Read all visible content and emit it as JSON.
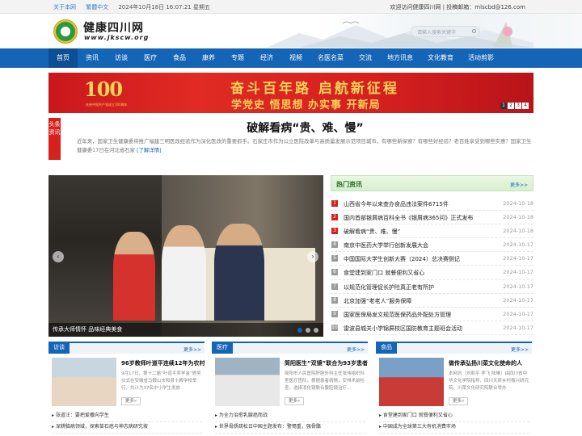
{
  "topbar": {
    "about": "关于本网",
    "traditional": "繁體中文",
    "datetime": "2024年10月18日 16:07:21 星期五",
    "welcome": "欢迎访问健康四川网 | 投稿邮箱：mlscbd@126.com"
  },
  "header": {
    "site_name": "健康四川网",
    "site_url": "www.jkscw.org",
    "search_placeholder": "请输入搜索关键字"
  },
  "nav": {
    "items": [
      "首页",
      "资讯",
      "访谈",
      "医疗",
      "食品",
      "康养",
      "专题",
      "经济",
      "视频",
      "名医名菜",
      "交流",
      "地方讯息",
      "文化教育",
      "活动剪影"
    ]
  },
  "banner": {
    "badge": "100",
    "badge_sub": "庆祝中国共产党成立100周年",
    "line1": "奋斗百年路  启航新征程",
    "line2": "学党史  悟思想  办实事  开新局",
    "pages": [
      "1",
      "2",
      "3",
      "4"
    ]
  },
  "headline": {
    "tag": "头条资讯",
    "title": "破解看病“贵、难、慢”",
    "body": "近年来，国家卫生健康委将推广福建三明医改经验作为深化医改的重要抓手。石家庄市作为公立医院改革与高质量发展示范项目城市，有哪些新探索？有哪些好经验？老百姓享受到哪些实惠？国家卫生健康委17日在河北省石家",
    "more": "[了解详情]"
  },
  "slider": {
    "caption": "传承大师情怀 品味经典美食",
    "prev": "‹",
    "next": "›"
  },
  "hot": {
    "title": "热门资讯",
    "more": "更多>>",
    "items": [
      {
        "n": "1",
        "title": "山西省今年以来查办食品违法案件6715件",
        "date": "2024-10-18"
      },
      {
        "n": "2",
        "title": "国内首部银屑病百科全书《银屑病365问》正式发布",
        "date": "2024-10-18"
      },
      {
        "n": "3",
        "title": "破解看病“贵、难、慢”",
        "date": "2024-10-18"
      },
      {
        "n": "4",
        "title": "南京中医药大学举行创新发展大会",
        "date": "2024-10-17"
      },
      {
        "n": "5",
        "title": "中国国际大学生创新大赛（2024）总决赛侧记",
        "date": "2024-10-17"
      },
      {
        "n": "6",
        "title": "食堂建到家门口 就餐便利又省心",
        "date": "2024-10-17"
      },
      {
        "n": "7",
        "title": "以规范化管理促长护险真正老有所护",
        "date": "2024-10-17"
      },
      {
        "n": "8",
        "title": "北京加强“老老人”服务保障",
        "date": "2024-10-17"
      },
      {
        "n": "9",
        "title": "国家医保局发文规范医保药品外配处方管理",
        "date": "2024-10-17"
      },
      {
        "n": "10",
        "title": "雷波县城关小学锦屏校区国防教育主题班会活动",
        "date": "2024-10-17"
      }
    ]
  },
  "columns": [
    {
      "title": "访谈",
      "more": "更多>>",
      "headline": "96岁教师叶道平连续12年为农村",
      "body": "9月17日，第十二届“叶道平奖学金”颁奖仪式在安徽省马鞍山市和县十殿学校举行，共计为37名中小学生发放",
      "more_btn": "更多»",
      "links": [
        "张道汪：要把爱撒向学生",
        "深耕脑病领域，探索苗石癌与神志病研究坡"
      ]
    },
    {
      "title": "医疗",
      "more": "更多>>",
      "headline": "简阳医生“双镜”联合为93岁患者",
      "body": "简阳市人民医院肝胆外科主任张伟组织科室医疗团队，根据患者病情，安排术前检查，选择消化镜联合腹腔镜治疗…",
      "more_btn": "更多»",
      "links": [
        "为全力治愈乳腺癌而战",
        "世界骨质疏松日中国主题发布：警惕重，强骨骼"
      ]
    },
    {
      "title": "食品",
      "more": "更多>>",
      "headline": "做传承弘扬川菜文化使命的人",
      "body": "本网讯（刘和平 李飞 陆琳）由四川省中华文化学院指导，四川天府乡村振兴研究院、川菜文化研究院联合举办",
      "more_btn": "更多»",
      "links": [
        "食堂建到家门口 就餐便利又省心",
        "中国成为全球第三大有机消费市场"
      ]
    }
  ]
}
